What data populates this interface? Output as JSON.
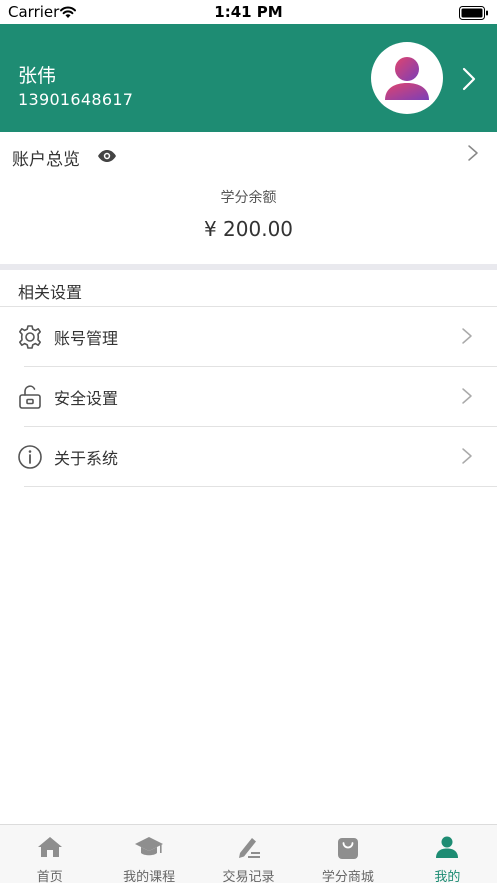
{
  "status_bar": {
    "carrier": "Carrier",
    "time": "1:41 PM"
  },
  "profile": {
    "name": "张伟",
    "phone": "13901648617"
  },
  "account": {
    "title": "账户总览",
    "balance_label": "学分余额",
    "balance_value": "¥ 200.00"
  },
  "settings": {
    "title": "相关设置",
    "items": [
      {
        "label": "账号管理",
        "icon": "gear-icon"
      },
      {
        "label": "安全设置",
        "icon": "lock-icon"
      },
      {
        "label": "关于系统",
        "icon": "info-icon"
      }
    ]
  },
  "tab_bar": {
    "tabs": [
      {
        "label": "首页",
        "icon": "home-icon"
      },
      {
        "label": "我的课程",
        "icon": "graduation-cap-icon"
      },
      {
        "label": "交易记录",
        "icon": "pencil-icon"
      },
      {
        "label": "学分商城",
        "icon": "shopping-bag-icon"
      },
      {
        "label": "我的",
        "icon": "user-icon"
      }
    ],
    "active_index": 4
  },
  "colors": {
    "accent": "#1e8c73",
    "tab_inactive": "#8e8e8e"
  }
}
